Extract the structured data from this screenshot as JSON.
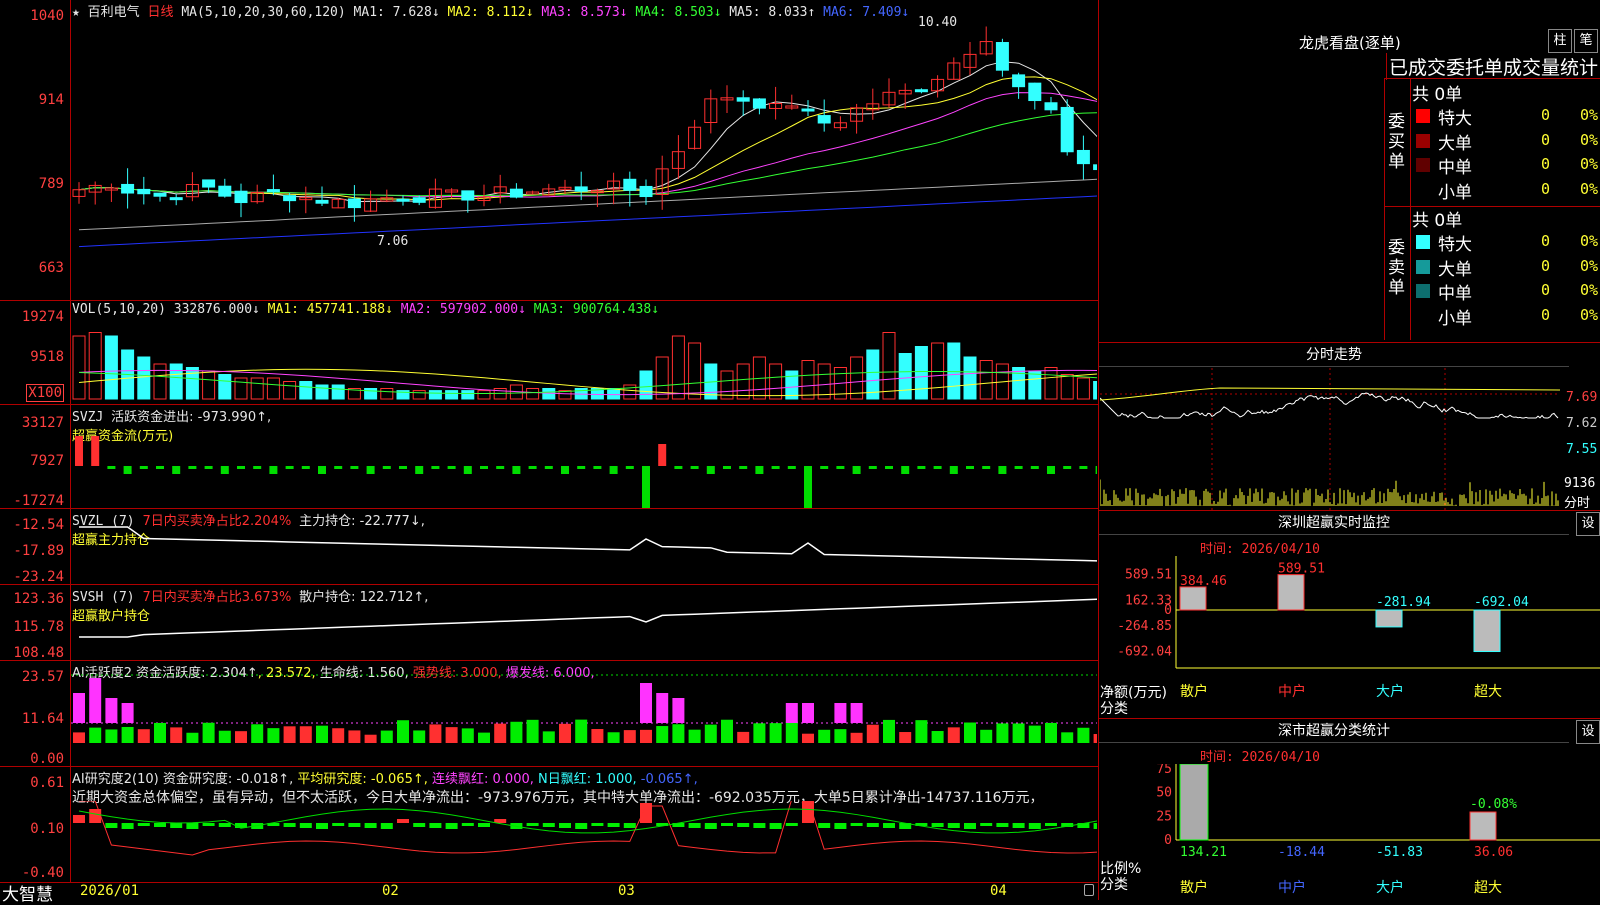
{
  "app": {
    "brand": "大智慧",
    "stock_name": "百利电气",
    "period": "日线"
  },
  "colors": {
    "up": "#ff3030",
    "down": "#33ffff",
    "ma1": "#e6e6e6",
    "ma2": "#ffff33",
    "ma3": "#ff44ff",
    "ma4": "#33ff33",
    "ma5": "#aaaaaa",
    "ma6": "#2233ff",
    "panel_border": "#b00000"
  },
  "price_panel": {
    "ma_title": "MA(5,10,20,30,60,120)",
    "ma1": "MA1: 7.628↓",
    "ma2": "MA2: 8.112↓",
    "ma3": "MA3: 8.573↓",
    "ma4": "MA4: 8.503↓",
    "ma5": "MA5: 8.033↑",
    "ma6": "MA6: 7.409↓",
    "y_ticks": [
      "1040",
      "914",
      "789",
      "663"
    ],
    "high_marker": "10.40",
    "low_marker": "7.06",
    "star": "★"
  },
  "vol_panel": {
    "title": "VOL(5,10,20)",
    "value": "332876.000↓",
    "ma1": "MA1: 457741.188↓",
    "ma2": "MA2: 597902.000↓",
    "ma3": "MA3: 900764.438↓",
    "y_ticks": [
      "19274",
      "9518"
    ],
    "unit": "X100"
  },
  "svzj_panel": {
    "title": "SVZJ",
    "label": "活跃资金进出: -973.990↑,",
    "sub": "超赢资金流(万元)",
    "y_ticks": [
      "33127",
      "7927",
      "-17274"
    ]
  },
  "svzl_panel": {
    "title": "SVZL (7)",
    "label1": "7日内买卖净占比2.204%",
    "label2": "主力持仓: -22.777↓,",
    "sub": "超赢主力持仓",
    "y_ticks": [
      "-12.54",
      "-17.89",
      "-23.24"
    ]
  },
  "svsh_panel": {
    "title": "SVSH (7)",
    "label1": "7日内买卖净占比3.673%",
    "label2": "散户持仓: 122.712↑,",
    "sub": "超赢散户持仓",
    "y_ticks": [
      "123.36",
      "115.78",
      "108.48"
    ]
  },
  "ai_active": {
    "title": "AI活跃度2",
    "l1": "资金活跃度: 2.304↑",
    "l2": ", 23.572,",
    "l3": "生命线: 1.560,",
    "l4": "强势线: 3.000,",
    "l5": "爆发线: 6.000,",
    "y_ticks": [
      "23.57",
      "11.64",
      "0.00"
    ]
  },
  "ai_research": {
    "title": "AI研究度2(10)",
    "l1": "资金研究度: -0.018↑,",
    "l2": "平均研究度: -0.065↑,",
    "l3": "连续飘红: 0.000,",
    "l4": "N日飘红: 1.000,",
    "l5": "-0.065↑,",
    "desc": "近期大资金总体偏空，虽有异动，但不太活跃，今日大单净流出：-973.976万元，其中特大单净流出：-692.035万元，大单5日累计净出-14737.116万元，",
    "y_ticks": [
      "0.61",
      "0.10",
      "-0.40"
    ]
  },
  "x_axis": [
    "2026/01",
    "02",
    "03",
    "04"
  ],
  "right": {
    "lhb_title": "龙虎看盘(逐单)",
    "btn1": "柱",
    "btn2": "笔",
    "tabs": "已成交委托单成交量统计",
    "buy": {
      "side": "委买单",
      "total": "共 0单",
      "rows": [
        {
          "name": "特大",
          "count": "0",
          "pct": "0%",
          "color": "#ff0000"
        },
        {
          "name": "大单",
          "count": "0",
          "pct": "0%",
          "color": "#9a0000"
        },
        {
          "name": "中单",
          "count": "0",
          "pct": "0%",
          "color": "#600000"
        },
        {
          "name": "小单",
          "count": "0",
          "pct": "0%",
          "color": ""
        }
      ]
    },
    "sell": {
      "side": "委卖单",
      "total": "共 0单",
      "rows": [
        {
          "name": "特大",
          "count": "0",
          "pct": "0%",
          "color": "#33ffff"
        },
        {
          "name": "大单",
          "count": "0",
          "pct": "0%",
          "color": "#159a9a"
        },
        {
          "name": "中单",
          "count": "0",
          "pct": "0%",
          "color": "#0d6e6e"
        },
        {
          "name": "小单",
          "count": "0",
          "pct": "0%",
          "color": ""
        }
      ]
    },
    "fenshi_title": "分时走势",
    "fenshi_y": [
      "7.69",
      "7.62",
      "7.55"
    ],
    "fenshi_vol": "9136",
    "fenshi_unit": "分时",
    "sz_title": "深圳超赢实时监控",
    "sz_btn": "设",
    "sz_time": "时间: 2026/04/10",
    "sz_y": [
      "589.51",
      "162.33",
      "0",
      "-264.85",
      "-692.04"
    ],
    "sz_unit": "净额(万元)",
    "sz_cat": "分类",
    "sz_cats": [
      "散户",
      "中户",
      "大户",
      "超大"
    ],
    "sz_vals": [
      "384.46",
      "589.51",
      "-281.94",
      "-692.04"
    ],
    "cls_title": "深市超赢分类统计",
    "cls_btn": "设",
    "cls_time": "时间: 2026/04/10",
    "cls_y": [
      "75",
      "50",
      "25",
      "0"
    ],
    "cls_unit": "比例%",
    "cls_cat": "分类",
    "cls_cats": [
      "散户",
      "中户",
      "大户",
      "超大"
    ],
    "cls_vals": [
      "134.21",
      "-18.44",
      "-51.83",
      "36.06"
    ],
    "cls_top": "-0.08%"
  }
}
